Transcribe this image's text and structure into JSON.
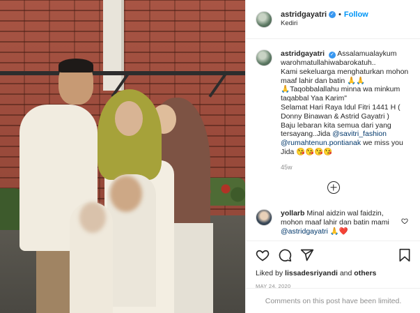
{
  "post": {
    "author": "astridgayatri",
    "follow_label": "Follow",
    "dot": "•",
    "location": "Kediri",
    "verified_mark": "✓"
  },
  "caption": {
    "username": "astridgayatri",
    "line1": "Assalamualaykum warohmatullahiwabarokatuh..",
    "line2": "Kami sekeluarga menghaturkan mohon maaf lahir dan batin 🙏🙏",
    "line3": "🙏Taqobbalallahu minna wa minkum taqabbal Yaa Karim\"",
    "line4": "Selamat Hari Raya Idul Fitri 1441 H ( Donny Binawan & Astrid Gayatri )",
    "line5": "Baju lebaran kita semua dari yang tersayang..Jida",
    "mention1": "@savitri_fashion",
    "mention2": "@rumahtenun.pontianak",
    "line6": "we miss you Jida 😘😘😘😘",
    "age": "45w"
  },
  "reply": {
    "username": "yollarb",
    "text": "Minal aidzin wal faidzin, mohon maaf lahir dan batin mami",
    "mention": "@astridgayatri",
    "emoji": "🙏❤️"
  },
  "likes": {
    "prefix": "Liked by",
    "user": "lissadesriyandi",
    "connector": "and",
    "others": "others"
  },
  "date": "MAY 24, 2020",
  "comments_notice": "Comments on this post have been limited.",
  "icons": {
    "like": "heart-icon",
    "comment": "comment-icon",
    "share": "share-icon",
    "save": "bookmark-icon",
    "load_more": "plus-circle-icon"
  },
  "colors": {
    "accent": "#0095f6",
    "verified": "#3897f0",
    "muted": "#8e8e8e",
    "text": "#262626",
    "mention": "#00376b"
  }
}
